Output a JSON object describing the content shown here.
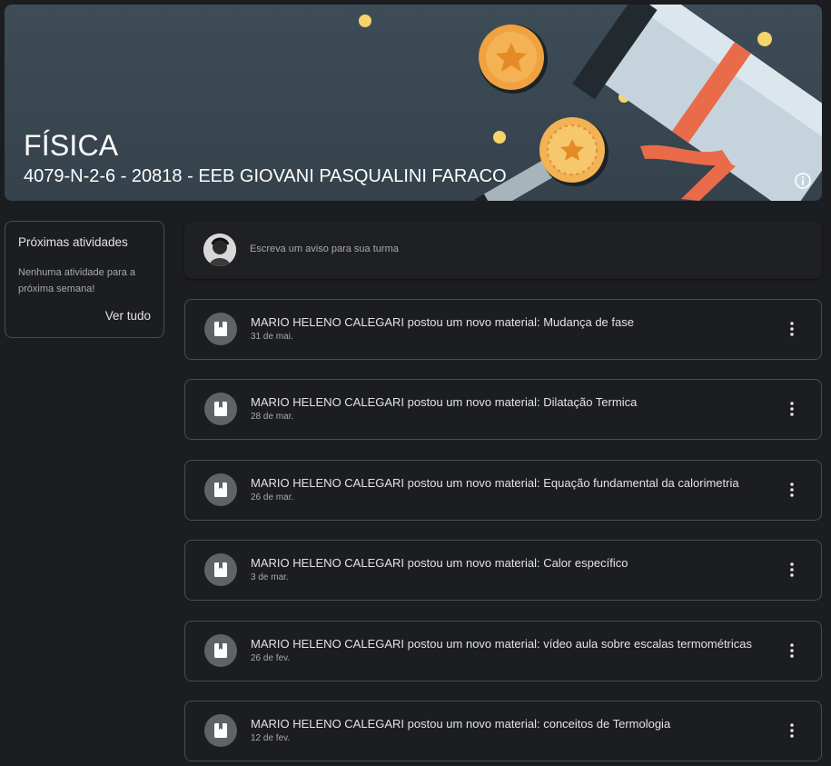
{
  "banner": {
    "title": "FÍSICA",
    "subtitle": "4079-N-2-6 - 20818 - EEB GIOVANI PASQUALINI FARACO",
    "info_icon": "info-icon",
    "background_color": "#3b4852"
  },
  "upcoming": {
    "title": "Próximas atividades",
    "empty_text": "Nenhuma atividade para a próxima semana!",
    "view_all_label": "Ver tudo"
  },
  "compose": {
    "placeholder": "Escreva um aviso para sua turma"
  },
  "stream": {
    "items": [
      {
        "title": "MARIO HELENO CALEGARI postou um novo material: Mudança de fase",
        "date": "31 de mai.",
        "icon": "material-icon"
      },
      {
        "title": "MARIO HELENO CALEGARI postou um novo material: Dilatação Termica",
        "date": "28 de mar.",
        "icon": "material-icon"
      },
      {
        "title": "MARIO HELENO CALEGARI postou um novo material: Equação fundamental da calorimetria",
        "date": "26 de mar.",
        "icon": "material-icon"
      },
      {
        "title": "MARIO HELENO CALEGARI postou um novo material: Calor específico",
        "date": "3 de mar.",
        "icon": "material-icon"
      },
      {
        "title": "MARIO HELENO CALEGARI postou um novo material: vídeo aula sobre escalas termométricas",
        "date": "26 de fev.",
        "icon": "material-icon"
      },
      {
        "title": "MARIO HELENO CALEGARI postou um novo material: conceitos de Termologia",
        "date": "12 de fev.",
        "icon": "material-icon"
      }
    ]
  }
}
